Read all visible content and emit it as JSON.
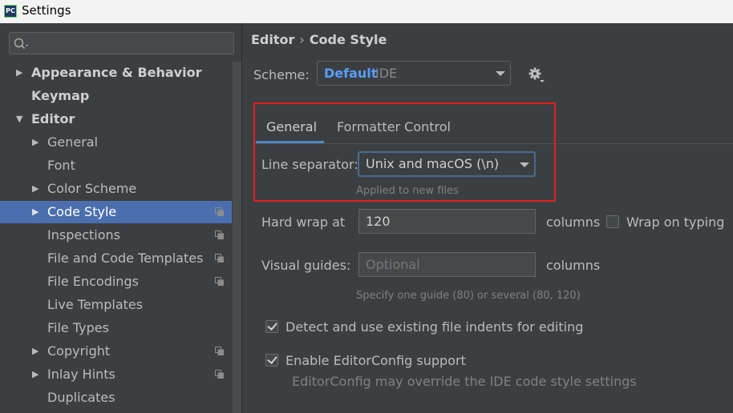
{
  "window": {
    "title": "Settings",
    "app_icon": "PC"
  },
  "search": {
    "placeholder": ""
  },
  "sidebar": {
    "items": [
      {
        "label": "Appearance & Behavior",
        "level": 0,
        "expandable": true,
        "expanded": false,
        "bold": true,
        "shared_icon": false,
        "selected": false
      },
      {
        "label": "Keymap",
        "level": 0,
        "expandable": false,
        "bold": true,
        "shared_icon": false,
        "selected": false
      },
      {
        "label": "Editor",
        "level": 0,
        "expandable": true,
        "expanded": true,
        "bold": true,
        "shared_icon": false,
        "selected": false
      },
      {
        "label": "General",
        "level": 1,
        "expandable": true,
        "expanded": false,
        "bold": false,
        "shared_icon": false,
        "selected": false
      },
      {
        "label": "Font",
        "level": 1,
        "expandable": false,
        "bold": false,
        "shared_icon": false,
        "selected": false
      },
      {
        "label": "Color Scheme",
        "level": 1,
        "expandable": true,
        "expanded": false,
        "bold": false,
        "shared_icon": false,
        "selected": false
      },
      {
        "label": "Code Style",
        "level": 1,
        "expandable": true,
        "expanded": false,
        "bold": false,
        "shared_icon": true,
        "selected": true
      },
      {
        "label": "Inspections",
        "level": 1,
        "expandable": false,
        "bold": false,
        "shared_icon": true,
        "selected": false
      },
      {
        "label": "File and Code Templates",
        "level": 1,
        "expandable": false,
        "bold": false,
        "shared_icon": true,
        "selected": false
      },
      {
        "label": "File Encodings",
        "level": 1,
        "expandable": false,
        "bold": false,
        "shared_icon": true,
        "selected": false
      },
      {
        "label": "Live Templates",
        "level": 1,
        "expandable": false,
        "bold": false,
        "shared_icon": false,
        "selected": false
      },
      {
        "label": "File Types",
        "level": 1,
        "expandable": false,
        "bold": false,
        "shared_icon": false,
        "selected": false
      },
      {
        "label": "Copyright",
        "level": 1,
        "expandable": true,
        "expanded": false,
        "bold": false,
        "shared_icon": true,
        "selected": false
      },
      {
        "label": "Inlay Hints",
        "level": 1,
        "expandable": true,
        "expanded": false,
        "bold": false,
        "shared_icon": true,
        "selected": false
      },
      {
        "label": "Duplicates",
        "level": 1,
        "expandable": false,
        "bold": false,
        "shared_icon": false,
        "selected": false
      }
    ]
  },
  "breadcrumb": {
    "parent": "Editor",
    "separator": "›",
    "current": "Code Style"
  },
  "scheme": {
    "label": "Scheme:",
    "value": "Default",
    "sub": "IDE"
  },
  "tabs": [
    {
      "label": "General",
      "active": true
    },
    {
      "label": "Formatter Control",
      "active": false
    }
  ],
  "line_separator": {
    "label": "Line separator:",
    "value": "Unix and macOS (\\n)",
    "hint": "Applied to new files"
  },
  "hard_wrap": {
    "label": "Hard wrap at",
    "value": "120",
    "unit": "columns"
  },
  "wrap_on_typing": {
    "label": "Wrap on typing",
    "checked": false
  },
  "visual_guides": {
    "label": "Visual guides:",
    "placeholder": "Optional",
    "unit": "columns",
    "hint": "Specify one guide (80) or several (80, 120)"
  },
  "detect_indents": {
    "label": "Detect and use existing file indents for editing",
    "checked": true
  },
  "editorconfig": {
    "label": "Enable EditorConfig support",
    "checked": true,
    "description": "EditorConfig may override the IDE code style settings"
  },
  "colors": {
    "accent": "#4b6eaf",
    "link": "#589df6",
    "highlight_box": "#e21d1d",
    "tab_underline": "#4a88c7"
  }
}
